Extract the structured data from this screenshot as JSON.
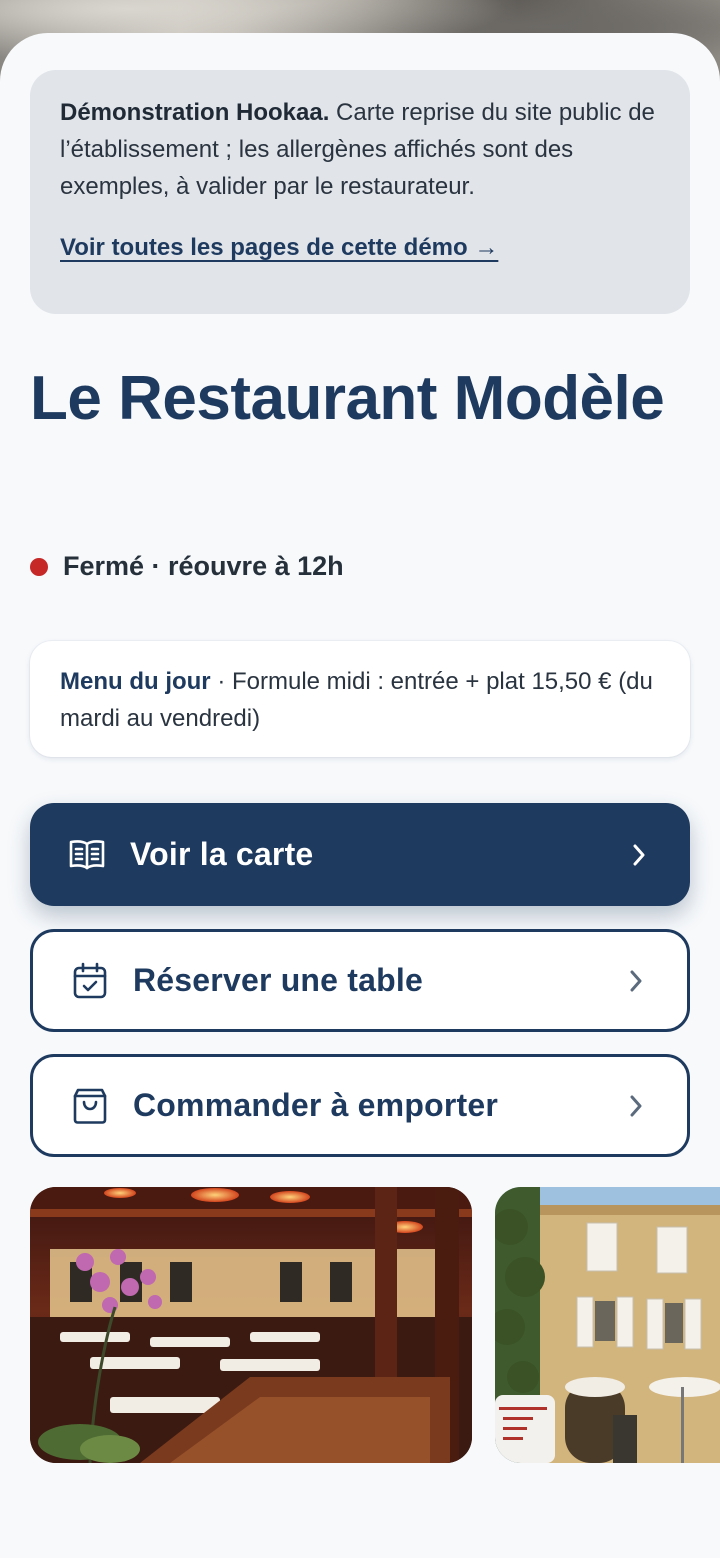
{
  "demo_notice": {
    "bold": "Démonstration Hookaa.",
    "text": " Carte reprise du site public de l’établissement ; les allergènes affichés sont des exemples, à valider par le restaurateur.",
    "link_label": "Voir toutes les pages de cette démo →"
  },
  "restaurant": {
    "name": "Le Restaurant Modèle",
    "status": "Fermé · réouvre à 12h",
    "status_color": "#c62828"
  },
  "menu_of_day": {
    "label": "Menu du jour",
    "separator": " · ",
    "text": "Formule midi : entrée + plat 15,50 € (du mardi au vendredi)"
  },
  "actions": [
    {
      "label": "Voir la carte",
      "icon": "open-book-icon",
      "style": "primary"
    },
    {
      "label": "Réserver une table",
      "icon": "calendar-check-icon",
      "style": "outline"
    },
    {
      "label": "Commander à emporter",
      "icon": "shopping-bag-icon",
      "style": "outline"
    }
  ],
  "colors": {
    "brand": "#1e3a5f",
    "background": "#f7f9fb",
    "notice_bg": "#e1e4e9"
  }
}
